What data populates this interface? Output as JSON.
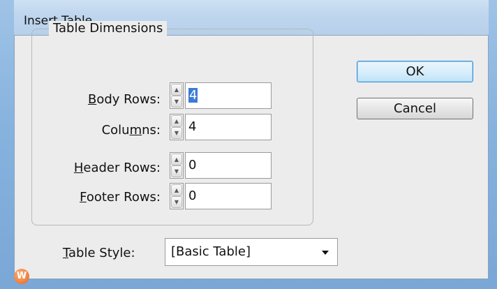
{
  "window": {
    "title": "Insert Table"
  },
  "group": {
    "legend": "Table Dimensions"
  },
  "fields": {
    "body_rows": {
      "label": "Body Rows:",
      "value": "4"
    },
    "columns": {
      "label": "Columns:",
      "value": "4"
    },
    "header_rows": {
      "label": "Header Rows:",
      "value": "0"
    },
    "footer_rows": {
      "label": "Footer Rows:",
      "value": "0"
    }
  },
  "buttons": {
    "ok": "OK",
    "cancel": "Cancel"
  },
  "table_style": {
    "label": "Table Style:",
    "value": "[Basic Table]"
  },
  "icons": {
    "spin_up": "spin-up-arrow",
    "spin_down": "spin-down-arrow",
    "dropdown": "chevron-down",
    "app_badge": "W"
  },
  "colors": {
    "selection": "#3b7bd6",
    "default_button_border": "#3b8fd6",
    "app_badge": "#e2661c"
  }
}
